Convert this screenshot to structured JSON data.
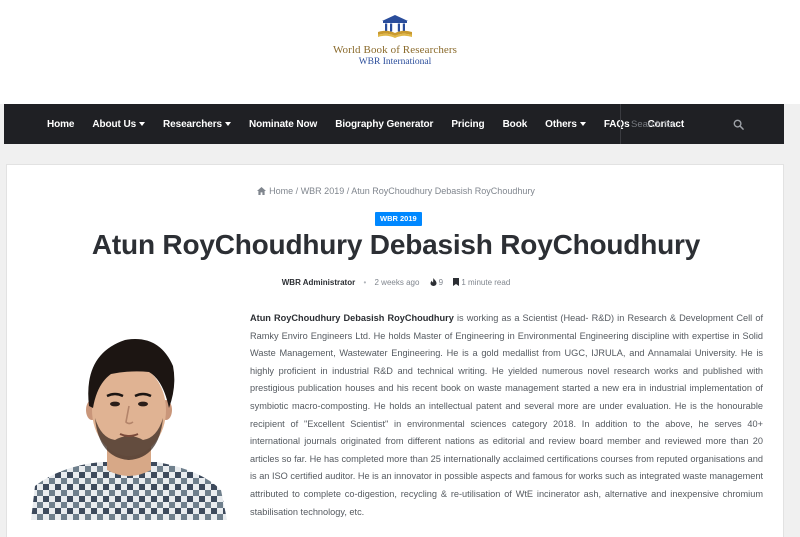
{
  "site": {
    "logo_title": "World Book of Researchers",
    "logo_subtitle": "WBR International"
  },
  "nav": {
    "items": [
      {
        "label": "Home",
        "dropdown": false
      },
      {
        "label": "About Us",
        "dropdown": true
      },
      {
        "label": "Researchers",
        "dropdown": true
      },
      {
        "label": "Nominate Now",
        "dropdown": false
      },
      {
        "label": "Biography Generator",
        "dropdown": false
      },
      {
        "label": "Pricing",
        "dropdown": false
      },
      {
        "label": "Book",
        "dropdown": false
      },
      {
        "label": "Others",
        "dropdown": true
      },
      {
        "label": "FAQs",
        "dropdown": false
      },
      {
        "label": "Contact",
        "dropdown": false
      }
    ],
    "search_placeholder": "Search for",
    "search_icon": "search-icon"
  },
  "breadcrumb": {
    "home": "Home",
    "sep1": " / ",
    "category": "WBR 2019",
    "sep2": " / ",
    "current": "Atun RoyChoudhury Debasish RoyChoudhury"
  },
  "post": {
    "category_badge": "WBR 2019",
    "title": "Atun RoyChoudhury Debasish RoyChoudhury",
    "author": "WBR Administrator",
    "date": "2 weeks ago",
    "views": "9",
    "read_time": "1 minute read",
    "bio_lead": "Atun RoyChoudhury Debasish RoyChoudhury",
    "bio_text": " is working as a Scientist (Head- R&D) in Research & Development Cell of Ramky Enviro Engineers Ltd. He holds Master of Engineering in Environmental Engineering discipline with expertise in Solid Waste Management, Wastewater Engineering. He is a gold medallist from UGC, IJRULA, and Annamalai University. He is highly proficient in industrial R&D and technical writing. He yielded numerous novel research works and published with prestigious publication houses and his recent book on waste management started a new era in industrial implementation of symbiotic macro-composting. He holds an intellectual patent and several more are under evaluation. He is the honourable recipient of \"Excellent Scientist\" in environmental sciences category 2018. In addition to the above, he serves 40+ international journals originated from different nations as editorial and review board member and reviewed more than 20 articles so far. He has completed more than 25 internationally acclaimed certifications courses from reputed organisations and is an ISO certified auditor. He is an innovator in possible aspects and famous for works such as integrated waste management attributed to complete co-digestion, recycling & re-utilisation of WtE incinerator ash, alternative and inexpensive chromium stabilisation technology, etc."
  },
  "colors": {
    "nav_bg": "#1f2024",
    "accent": "#0088ff",
    "logo_gold": "#8a6a2b",
    "logo_blue": "#2a4d9b"
  }
}
